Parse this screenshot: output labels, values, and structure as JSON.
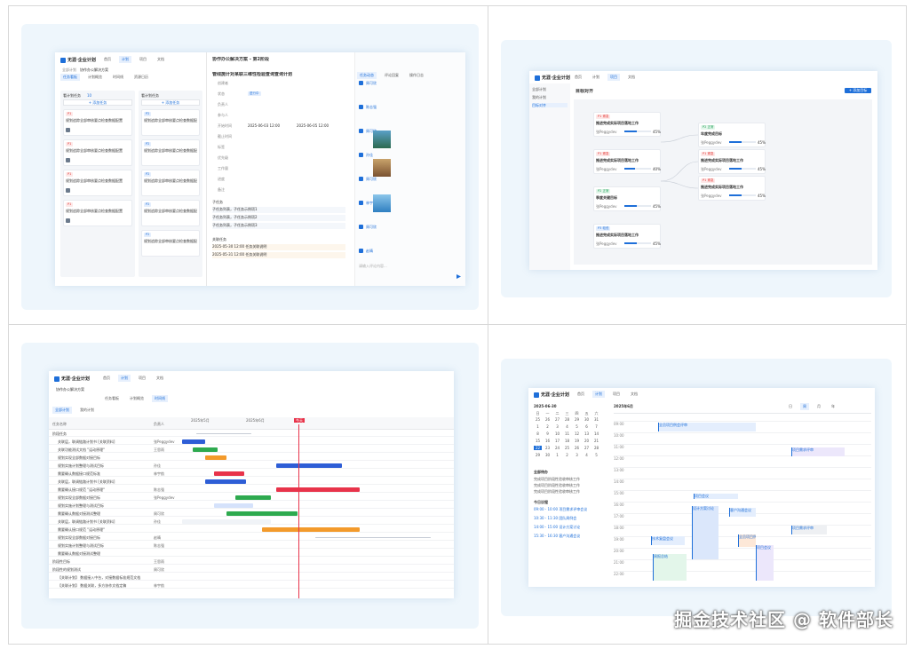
{
  "app": {
    "name": "无涯·企业计划",
    "nav": [
      "首页",
      "计划",
      "项目",
      "文档"
    ]
  },
  "q1": {
    "crumb": "全部计划",
    "plan": "协作办公解决方案",
    "tabs": [
      "任务看板",
      "计划概览",
      "时间线",
      "资源日历"
    ],
    "cols": [
      {
        "title": "看计划任务",
        "count": "10",
        "add": "+ 添加任务"
      },
      {
        "title": "看计划任务",
        "count": "10",
        "add": "+ 添加任务"
      }
    ],
    "card_text": "规划追踪全部审核要点检查数据配置",
    "detail": {
      "title": "协作办公解决方案 - 第2阶段",
      "task": "管线施计对某联三维性检验查询查询计划",
      "fields": [
        "创建者",
        "状态",
        "负责人",
        "参与人",
        "开始时间",
        "截止时间",
        "标签",
        "优先级",
        "工作量",
        "进度",
        "备注"
      ],
      "status": "进行中",
      "start": "2025-06-03 12:00",
      "end": "2025-06-05 12:00",
      "sub_title": "子任务",
      "sub_items": [
        "子任务列表，子任务示例项1",
        "子任务列表，子任务示例项2",
        "子任务列表，子任务示例项3"
      ],
      "rel_title": "关联任务",
      "rel_items": [
        "2025-05-30 12:00 任务关联说明",
        "2025-05-31 12:00 任务关联说明"
      ]
    },
    "comments": {
      "tabs": [
        "任务动态",
        "评论回复",
        "操作日志"
      ],
      "names": [
        "周可欣",
        "陈志强",
        "周可欣",
        "孙佳",
        "周可欣",
        "林宇航",
        "周可欣",
        "赵晴"
      ],
      "placeholder": "请输入评论内容..."
    }
  },
  "q2": {
    "title": "目标对齐",
    "btn": "+ 添加目标",
    "left": [
      {
        "tag": "P1 紧急",
        "title": "推进完成实际项目落地工作",
        "pct": "45%"
      },
      {
        "tag": "P1 紧急",
        "title": "推进完成实际项目落地工作",
        "pct": "40%"
      },
      {
        "tag": "P2 正常",
        "title": "季度关键目标",
        "pct": "45%"
      },
      {
        "tag": "P3 较低",
        "title": "推进完成实际项目落地工作",
        "pct": "45%"
      }
    ],
    "right": [
      {
        "tag": "P2 正常",
        "title": "年度完成目标",
        "pct": "45%"
      },
      {
        "tag": "P1 紧急",
        "title": "推进完成实际项目落地工作",
        "pct": "45%"
      },
      {
        "tag": "P1 紧急",
        "title": "推进完成实际项目落地工作",
        "pct": "45%"
      }
    ],
    "owner": "张Peggydev"
  },
  "q3": {
    "plan": "协作办公解决方案",
    "tabs": [
      "任务看板",
      "计划概览",
      "时间线"
    ],
    "sub": [
      "全部计划",
      "我的计划"
    ],
    "col_name": "任务名称",
    "col_owner": "负责人",
    "month1": "2025年5月",
    "month2": "2025年6月",
    "rows": [
      "阶段任务",
      "关联层，联调链路计划书 [关联资料]",
      "关联功能测试文档 \"运动原理\"",
      "规划实现全部数据对接目标",
      "规划实施计划整理与测试目标",
      "需要确认数据接口规范标准",
      "关联层，联调链路计划书 [关联资料]",
      "需要确认接口规范 \"运动原理\"",
      "规划实现全部数据对接目标",
      "规划实施计划整理与测试目标",
      "需要确认数据对接测试整理",
      "关联层，联调链路计划书 [关联资料]",
      "需要确认接口规范 \"运动原理\"",
      "规划实现全部数据对接目标",
      "规划实施计划整理与测试目标",
      "需要确认数据对接测试整理",
      "阶段性目标",
      "阶段性的规划测试",
      "【关联计划】 数据接入中台，对接数据标准规范文档",
      "【关联计划】 数据关联，多方协作文档定稿"
    ],
    "owners": [
      "陈志强",
      "张Peggydev",
      "王思雨",
      "周可欣",
      "孙佳",
      "林宇航",
      "赵晴"
    ],
    "today": "今天"
  },
  "q4": {
    "date": "2025-06-30",
    "month": "2025年6月",
    "weekdays": [
      "日",
      "一",
      "二",
      "三",
      "四",
      "五",
      "六"
    ],
    "days": [
      "25",
      "26",
      "27",
      "28",
      "29",
      "30",
      "31",
      "1",
      "2",
      "3",
      "4",
      "5",
      "6",
      "7",
      "8",
      "9",
      "10",
      "11",
      "12",
      "13",
      "14",
      "15",
      "16",
      "17",
      "18",
      "19",
      "20",
      "21",
      "22",
      "23",
      "24",
      "25",
      "26",
      "27",
      "28",
      "29",
      "30",
      "1",
      "2",
      "3",
      "4",
      "5"
    ],
    "views": [
      "日",
      "周",
      "月",
      "年"
    ],
    "list_title": "全部待办",
    "list": [
      "完成项目阶段性验收审核工作",
      "完成项目阶段性验收审核工作",
      "完成项目阶段性验收审核工作"
    ],
    "agenda_title": "今日议程",
    "agenda": [
      "09:00 - 10:00 项目需求评审会议",
      "10:30 - 11:30 团队周例会",
      "14:00 - 15:00 设计方案讨论",
      "15:30 - 16:30 客户沟通会议"
    ],
    "hours": [
      "09:00",
      "10:00",
      "11:00",
      "12:00",
      "13:00",
      "14:00",
      "15:00",
      "16:00",
      "17:00",
      "18:00",
      "19:00",
      "20:00",
      "21:00",
      "22:00"
    ],
    "events": [
      "全员项目例会评审",
      "项目需求评审",
      "项目会议",
      "设计方案讨论",
      "客户沟通会议",
      "技术复盘会议",
      "周报总结"
    ]
  },
  "watermark": "掘金技术社区 @ 软件部长",
  "colors": {
    "accent": "#1e6fd9",
    "red": "#e8334a",
    "green": "#2eaa4f",
    "orange": "#f39a2b"
  }
}
